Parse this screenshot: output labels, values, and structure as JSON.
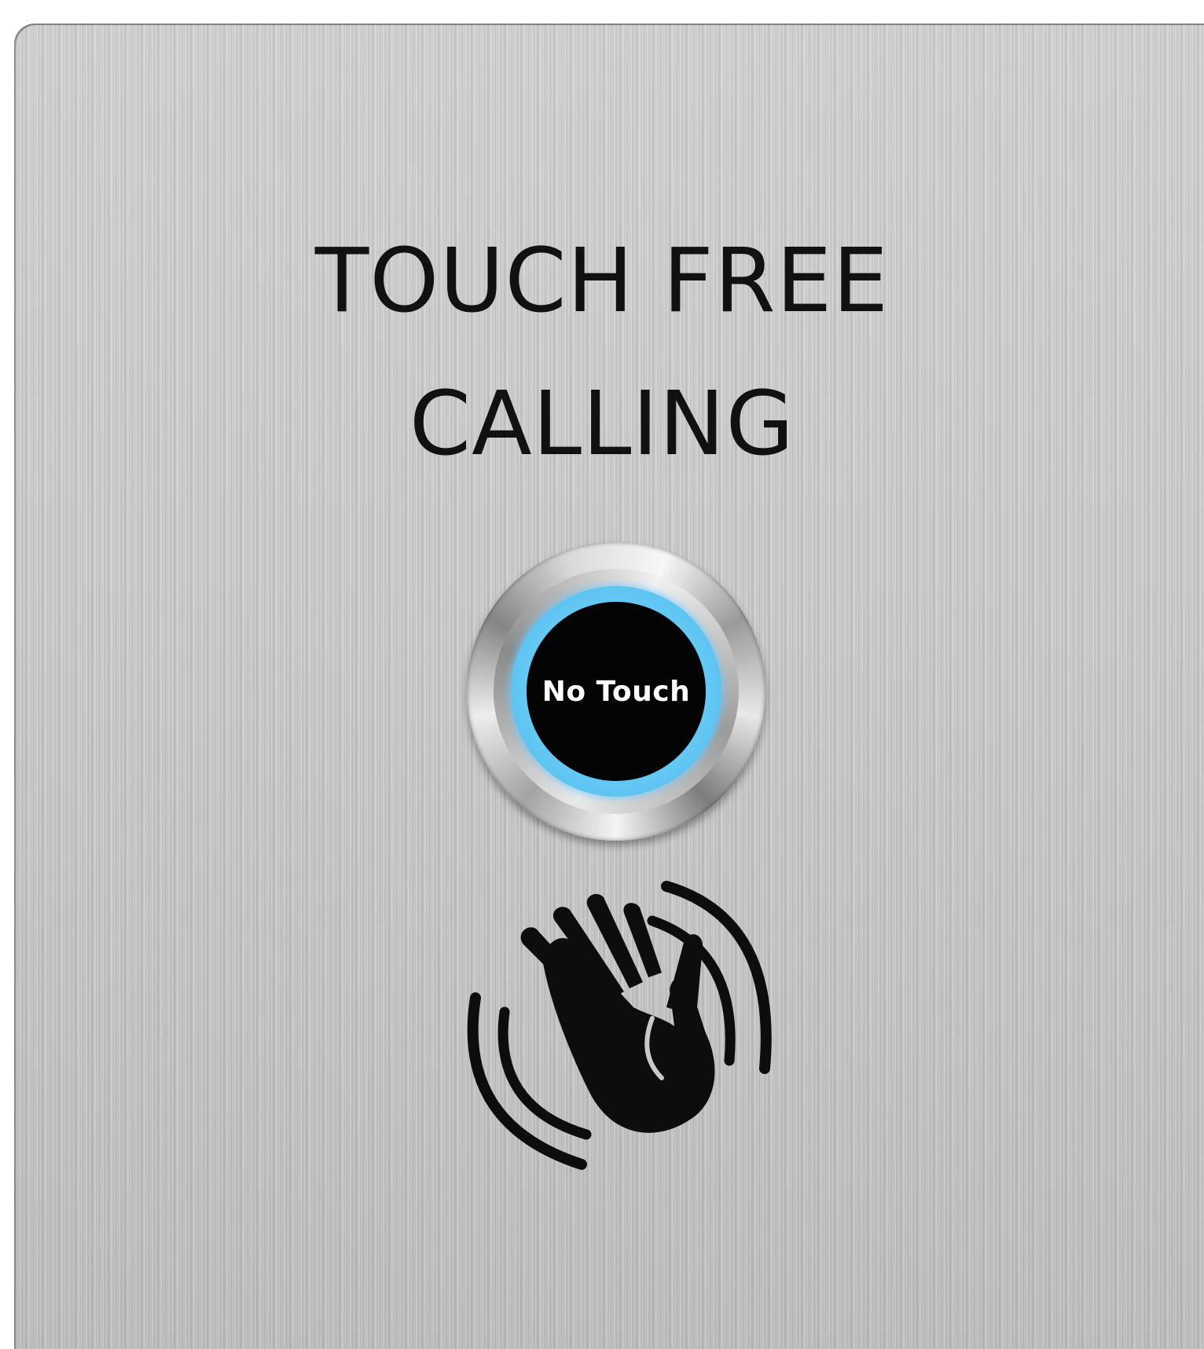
{
  "sign": {
    "line1": "TOUCH FREE",
    "line2": "CALLING"
  },
  "button": {
    "label": "No Touch",
    "ring_color": "#5ec4f2",
    "core_color": "#040404"
  },
  "icons": {
    "gesture": "hand-wave-icon"
  },
  "colors": {
    "plate": "#c9c9c9",
    "text": "#111111"
  }
}
